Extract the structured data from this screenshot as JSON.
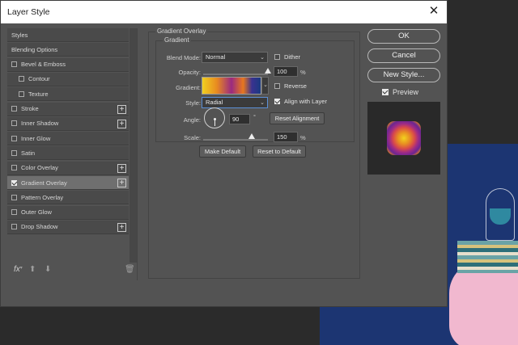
{
  "window": {
    "title": "Layer Style",
    "close_glyph": "✕"
  },
  "styles_list": [
    {
      "label": "Styles",
      "checkbox": false,
      "checked": false,
      "plus": false,
      "indent": 0
    },
    {
      "label": "Blending Options",
      "checkbox": false,
      "checked": false,
      "plus": false,
      "indent": 0
    },
    {
      "label": "Bevel & Emboss",
      "checkbox": true,
      "checked": false,
      "plus": false,
      "indent": 0
    },
    {
      "label": "Contour",
      "checkbox": true,
      "checked": false,
      "plus": false,
      "indent": 1
    },
    {
      "label": "Texture",
      "checkbox": true,
      "checked": false,
      "plus": false,
      "indent": 1
    },
    {
      "label": "Stroke",
      "checkbox": true,
      "checked": false,
      "plus": true,
      "indent": 0
    },
    {
      "label": "Inner Shadow",
      "checkbox": true,
      "checked": false,
      "plus": true,
      "indent": 0
    },
    {
      "label": "Inner Glow",
      "checkbox": true,
      "checked": false,
      "plus": false,
      "indent": 0
    },
    {
      "label": "Satin",
      "checkbox": true,
      "checked": false,
      "plus": false,
      "indent": 0
    },
    {
      "label": "Color Overlay",
      "checkbox": true,
      "checked": false,
      "plus": true,
      "indent": 0
    },
    {
      "label": "Gradient Overlay",
      "checkbox": true,
      "checked": true,
      "plus": true,
      "indent": 0,
      "selected": true
    },
    {
      "label": "Pattern Overlay",
      "checkbox": true,
      "checked": false,
      "plus": false,
      "indent": 0
    },
    {
      "label": "Outer Glow",
      "checkbox": true,
      "checked": false,
      "plus": false,
      "indent": 0
    },
    {
      "label": "Drop Shadow",
      "checkbox": true,
      "checked": false,
      "plus": true,
      "indent": 0
    }
  ],
  "footer_icons": [
    "fx-icon",
    "move-up-icon",
    "move-down-icon",
    "trash-icon"
  ],
  "overlay": {
    "group_title": "Gradient Overlay",
    "subgroup_title": "Gradient",
    "blend_mode_label": "Blend Mode:",
    "blend_mode_value": "Normal",
    "dither_label": "Dither",
    "opacity_label": "Opacity:",
    "opacity_value": "100",
    "opacity_unit": "%",
    "gradient_label": "Gradient:",
    "reverse_label": "Reverse",
    "style_label": "Style:",
    "style_value": "Radial",
    "align_label": "Align with Layer",
    "angle_label": "Angle:",
    "angle_value": "90",
    "angle_unit": "°",
    "reset_alignment_label": "Reset Alignment",
    "scale_label": "Scale:",
    "scale_value": "150",
    "scale_unit": "%",
    "make_default_label": "Make Default",
    "reset_default_label": "Reset to Default",
    "opacity_level": 1.0,
    "scale_level": 0.75,
    "dither_checked": false,
    "reverse_checked": false,
    "align_checked": true
  },
  "actions": {
    "ok_label": "OK",
    "cancel_label": "Cancel",
    "new_style_label": "New Style...",
    "preview_label": "Preview",
    "preview_checked": true
  },
  "colors": {
    "dialog_bg": "#535353",
    "gradient_stops": [
      "#f0d020",
      "#e88a20",
      "#9a2a80",
      "#3a3290",
      "#1a3a80"
    ]
  }
}
